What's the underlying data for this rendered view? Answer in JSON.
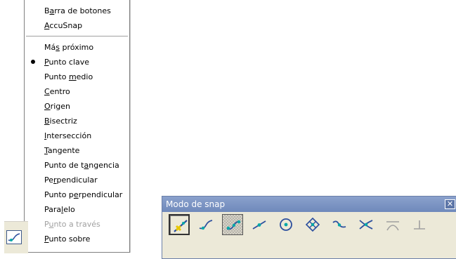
{
  "context_menu": {
    "items": [
      {
        "pre": "B",
        "u": "a",
        "post": "rra de botones"
      },
      {
        "pre": "",
        "u": "A",
        "post": "ccuSnap"
      },
      {
        "pre": "Má",
        "u": "s",
        "post": " próximo"
      },
      {
        "pre": "",
        "u": "P",
        "post": "unto clave",
        "checked": true
      },
      {
        "pre": "Punto ",
        "u": "m",
        "post": "edio"
      },
      {
        "pre": "",
        "u": "C",
        "post": "entro"
      },
      {
        "pre": "",
        "u": "O",
        "post": "rigen"
      },
      {
        "pre": "",
        "u": "B",
        "post": "isectriz"
      },
      {
        "pre": "",
        "u": "I",
        "post": "ntersección"
      },
      {
        "pre": "",
        "u": "T",
        "post": "angente"
      },
      {
        "pre": "Punto de t",
        "u": "a",
        "post": "ngencia"
      },
      {
        "pre": "Pe",
        "u": "r",
        "post": "pendicular"
      },
      {
        "pre": "Punto p",
        "u": "e",
        "post": "rpendicular"
      },
      {
        "pre": "Para",
        "u": "l",
        "post": "elo"
      },
      {
        "pre": "P",
        "u": "u",
        "post": "nto a través",
        "disabled": true
      },
      {
        "pre": "",
        "u": "P",
        "post": "unto sobre"
      }
    ]
  },
  "snap_toolbar": {
    "title": "Modo de snap",
    "close_glyph": "✕",
    "buttons": [
      {
        "icon": "keypoint-snap-override-icon",
        "state": "pressed"
      },
      {
        "icon": "nearest-snap-icon",
        "state": "normal"
      },
      {
        "icon": "keypoint-snap-icon",
        "state": "checked"
      },
      {
        "icon": "midpoint-snap-icon",
        "state": "normal"
      },
      {
        "icon": "center-snap-icon",
        "state": "normal"
      },
      {
        "icon": "origin-snap-icon",
        "state": "normal"
      },
      {
        "icon": "bisector-snap-icon",
        "state": "normal"
      },
      {
        "icon": "intersection-snap-icon",
        "state": "normal"
      },
      {
        "icon": "tangent-snap-icon",
        "state": "disabled"
      },
      {
        "icon": "perpendicular-snap-icon",
        "state": "disabled"
      }
    ]
  },
  "colors": {
    "toolbar_face": "#ece9d8",
    "title_bar": "#7990c0",
    "icon_blue": "#2c4f9e",
    "icon_cyan": "#00a8a8",
    "disabled": "#a0a0a0"
  }
}
